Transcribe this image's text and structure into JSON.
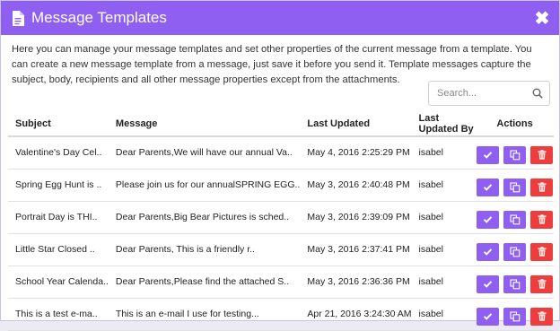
{
  "dialog": {
    "title": "Message Templates",
    "close_glyph": "✖",
    "intro": "Here you can manage your message templates and set other properties of the current message from a template. You can create a new message template from a message, just save it before you send it. Template messages capture the subject, body, recipients and all other message properties except from the attachments."
  },
  "search": {
    "placeholder": "Search..."
  },
  "table": {
    "headers": {
      "subject": "Subject",
      "message": "Message",
      "last_updated": "Last Updated",
      "last_updated_by": "Last Updated By",
      "actions": "Actions"
    },
    "rows": [
      {
        "subject": "Valentine's Day Cel..",
        "message": "Dear Parents,We will have our annual Va..",
        "last_updated": "May 4, 2016 2:25:29 PM",
        "by": "isabel"
      },
      {
        "subject": "Spring Egg Hunt is ..",
        "message": "Please join us for our annualSPRING EGG..",
        "last_updated": "May 3, 2016 2:40:48 PM",
        "by": "isabel"
      },
      {
        "subject": "Portrait Day is THI..",
        "message": "Dear Parents,Big Bear Pictures is sched..",
        "last_updated": "May 3, 2016 2:39:09 PM",
        "by": "isabel"
      },
      {
        "subject": "Little Star Closed ..",
        "message": "Dear Parents, This is a friendly r..",
        "last_updated": "May 3, 2016 2:37:41 PM",
        "by": "isabel"
      },
      {
        "subject": "School Year Calenda..",
        "message": "Dear Parents,Please find the attached S..",
        "last_updated": "May 3, 2016 2:36:36 PM",
        "by": "isabel"
      },
      {
        "subject": "This is a test e-ma..",
        "message": "This is an e-mail I use for testing...",
        "last_updated": "Apr 21, 2016 3:24:30 AM",
        "by": "isabel"
      }
    ]
  },
  "icons": {
    "header": "document-icon",
    "search": "search-icon",
    "use": "check-icon",
    "copy": "copy-icon",
    "delete": "trash-icon"
  },
  "colors": {
    "accent": "#8e5ff0",
    "danger": "#ee3d3d"
  }
}
